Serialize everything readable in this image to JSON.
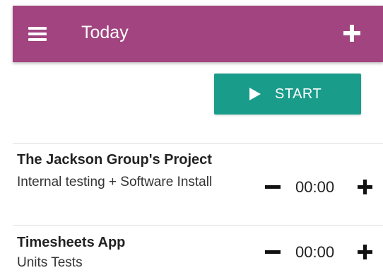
{
  "appbar": {
    "title": "Today"
  },
  "actions": {
    "start_label": "START"
  },
  "entries": [
    {
      "project": "The Jackson Group's Project",
      "task": "Internal testing + Software Install",
      "time": "00:00"
    },
    {
      "project": "Timesheets App",
      "task": "Units Tests",
      "time": "00:00"
    }
  ],
  "colors": {
    "appbar": "#a1447f",
    "start_button": "#1a9c8a"
  },
  "icons": [
    "menu-icon",
    "add-icon",
    "play-icon",
    "minus-icon",
    "plus-icon"
  ]
}
